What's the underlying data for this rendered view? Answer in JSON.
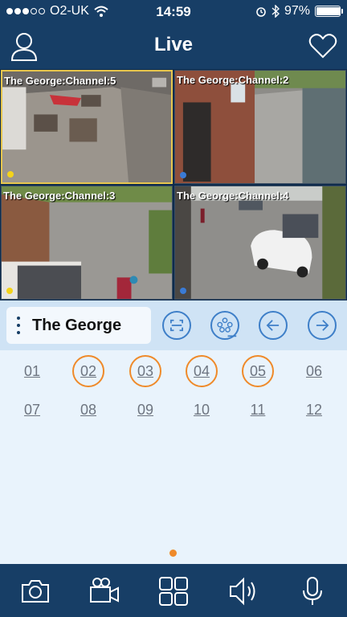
{
  "status_bar": {
    "carrier": "O2-UK",
    "time": "14:59",
    "battery": "97%",
    "battery_level": 0.97
  },
  "header": {
    "title": "Live",
    "user_icon": "user-icon",
    "favorite_icon": "heart-icon"
  },
  "grid": {
    "tiles": [
      {
        "label": "The George:Channel:5",
        "indicator_color": "#f4d31a",
        "selected": true
      },
      {
        "label": "The George:Channel:2",
        "indicator_color": "#3a7bd5",
        "selected": false
      },
      {
        "label": "The George:Channel:3",
        "indicator_color": "#f4d31a",
        "selected": false
      },
      {
        "label": "The George:Channel:4",
        "indicator_color": "#3a7bd5",
        "selected": false
      }
    ]
  },
  "controls": {
    "site_name": "The George",
    "buttons": [
      "fullscreen-icon",
      "film-reel-icon",
      "arrow-left-icon",
      "arrow-right-icon"
    ]
  },
  "channels": {
    "items": [
      "01",
      "02",
      "03",
      "04",
      "05",
      "06",
      "07",
      "08",
      "09",
      "10",
      "11",
      "12"
    ],
    "active": [
      "02",
      "03",
      "04",
      "05"
    ],
    "active_color": "#ef8a2a"
  },
  "toolbar": {
    "buttons": [
      "camera-icon",
      "video-camera-icon",
      "layout-grid-icon",
      "speaker-icon",
      "microphone-icon"
    ]
  },
  "colors": {
    "header": "#173e66",
    "accent": "#3e7fc8",
    "background": "#e9f3fc"
  }
}
